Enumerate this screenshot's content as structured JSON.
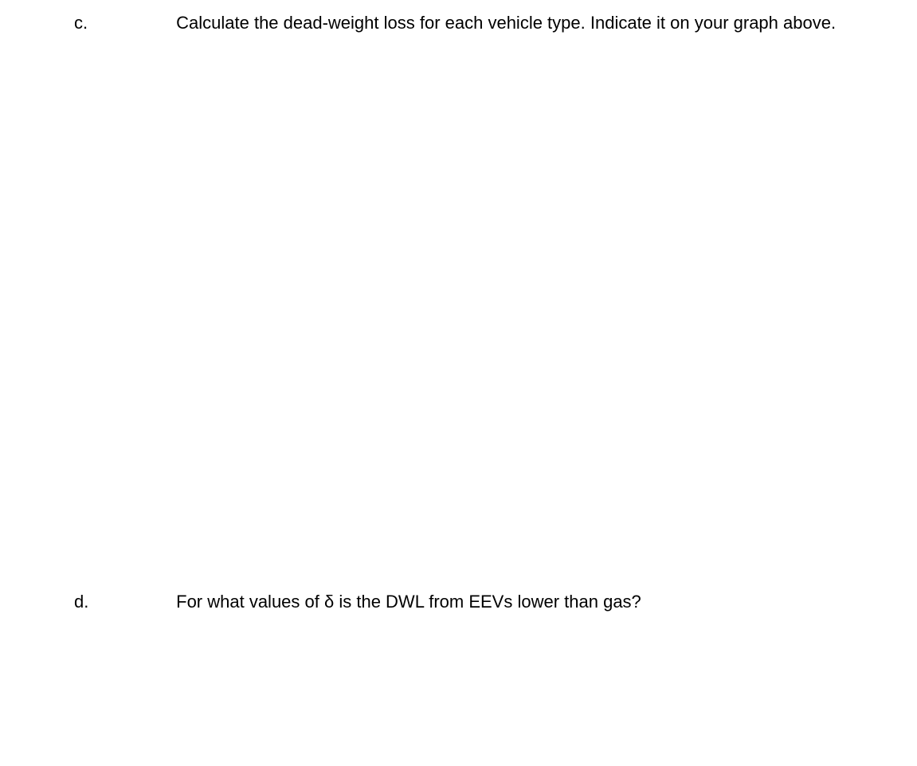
{
  "items": {
    "c": {
      "marker": "c.",
      "redacted": " ",
      "text": " Calculate the dead-weight loss for each vehicle type. Indicate it on your graph above."
    },
    "d": {
      "marker": "d.",
      "redacted": " ",
      "text": " For what values of δ is the DWL from EEVs lower than gas?"
    }
  }
}
